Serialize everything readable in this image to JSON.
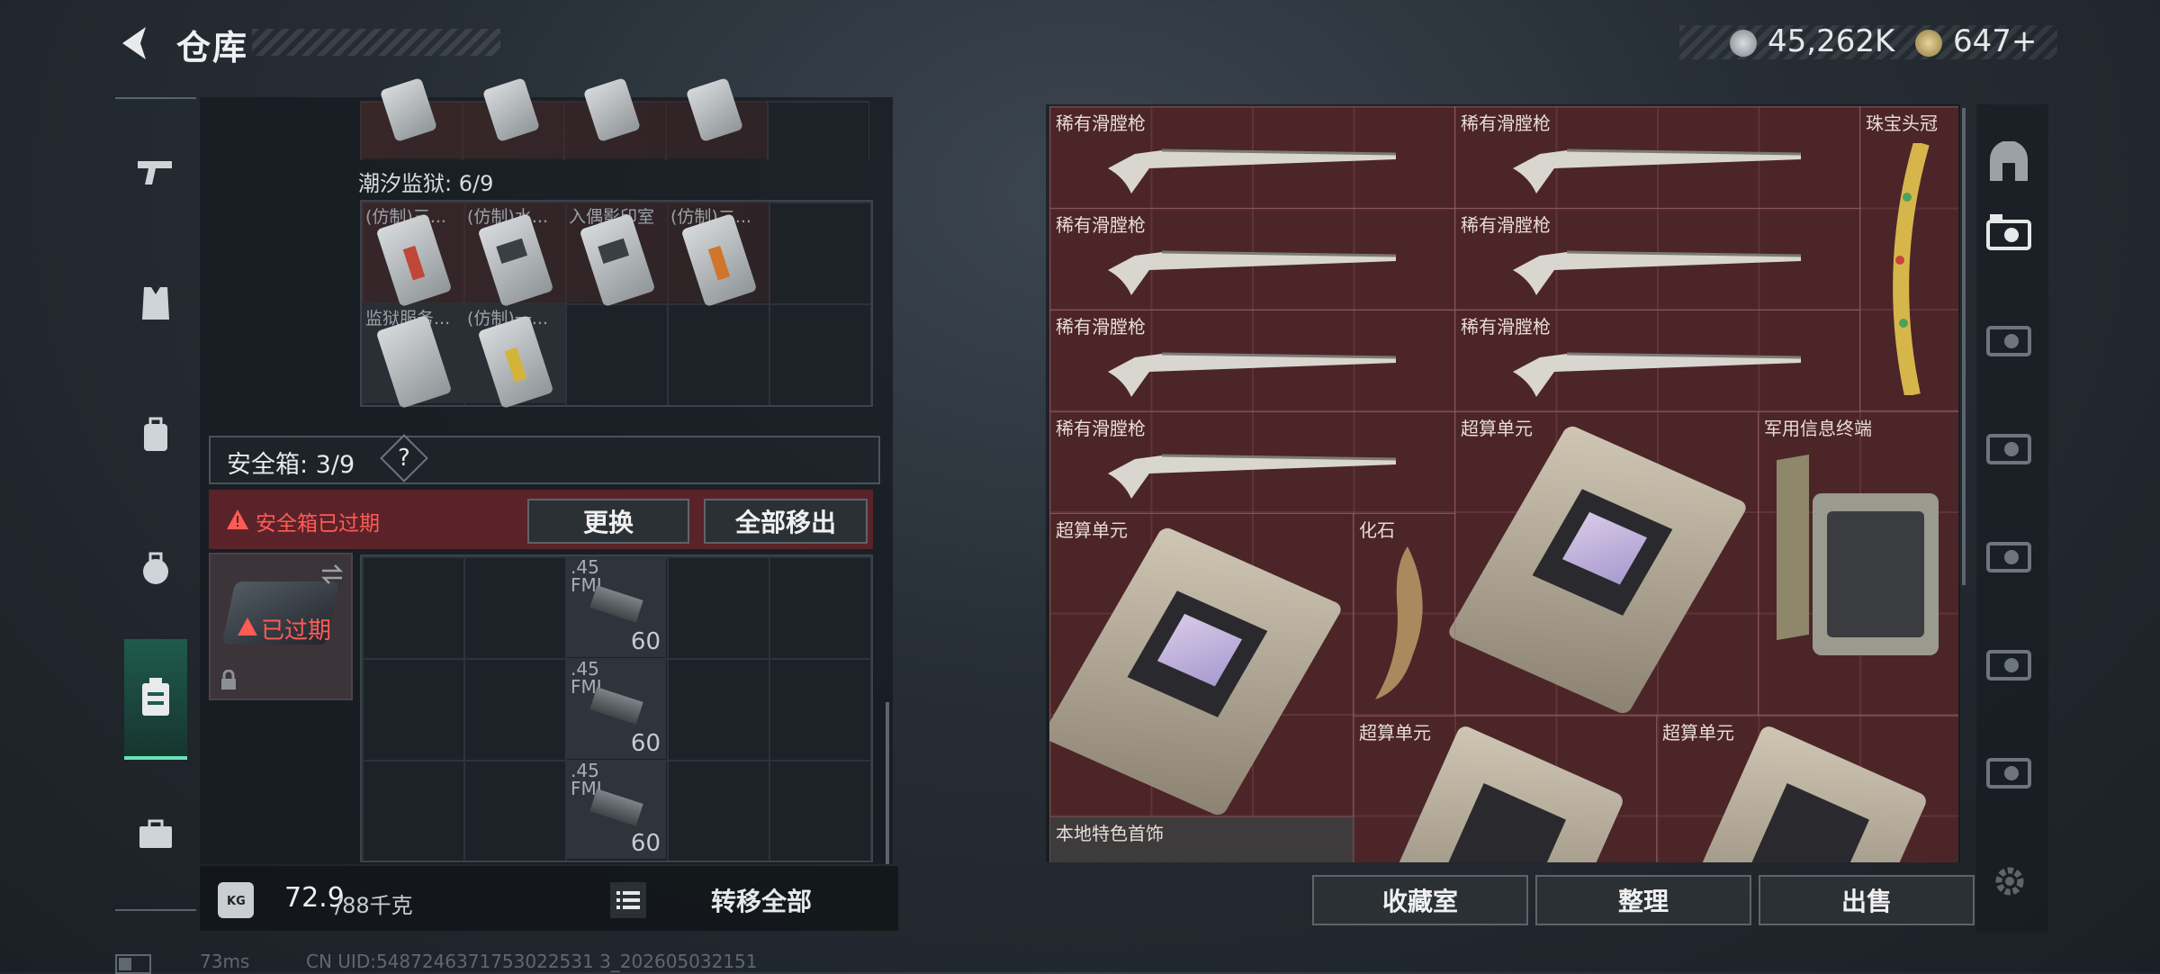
{
  "header": {
    "title": "仓库"
  },
  "currency": {
    "primary": "45,262K",
    "secondary": "647+"
  },
  "left": {
    "prison_section": "潮汐监狱: 6/9",
    "prison_items": [
      "(仿制)三...",
      "(仿制)水...",
      "入偶影印室",
      "(仿制)二...",
      "监狱服务...",
      "(仿制)一..."
    ],
    "safebox": {
      "title": "安全箱: 3/9",
      "help": "?",
      "warning": "安全箱已过期",
      "replace": "更换",
      "move_all": "全部移出",
      "expired_tag": "已过期"
    },
    "ammo": [
      {
        "caliber": ".45",
        "sub": "FMJ",
        "count": "60"
      },
      {
        "caliber": ".45",
        "sub": "FMJ",
        "count": "60"
      },
      {
        "caliber": ".45",
        "sub": "FMJ",
        "count": "60"
      }
    ],
    "weight": {
      "current": "72.9",
      "max": "/88千克"
    },
    "transfer_all": "转移全部"
  },
  "stash": {
    "items": [
      "稀有滑膛枪",
      "稀有滑膛枪",
      "珠宝头冠",
      "稀有滑膛枪",
      "稀有滑膛枪",
      "稀有滑膛枪",
      "稀有滑膛枪",
      "稀有滑膛枪",
      "超算单元",
      "军用信息终端",
      "超算单元",
      "化石",
      "超算单元",
      "超算单元",
      "本地特色首饰"
    ],
    "buttons": {
      "collection": "收藏室",
      "sort": "整理",
      "sell": "出售"
    }
  },
  "status": {
    "latency": "73ms",
    "uid": "CN UID:5487246371753022531 3_202605032151"
  },
  "colors": {
    "accent": "#67e3b5",
    "warning": "#ff5b55",
    "stash_bg": "#4c2529"
  }
}
